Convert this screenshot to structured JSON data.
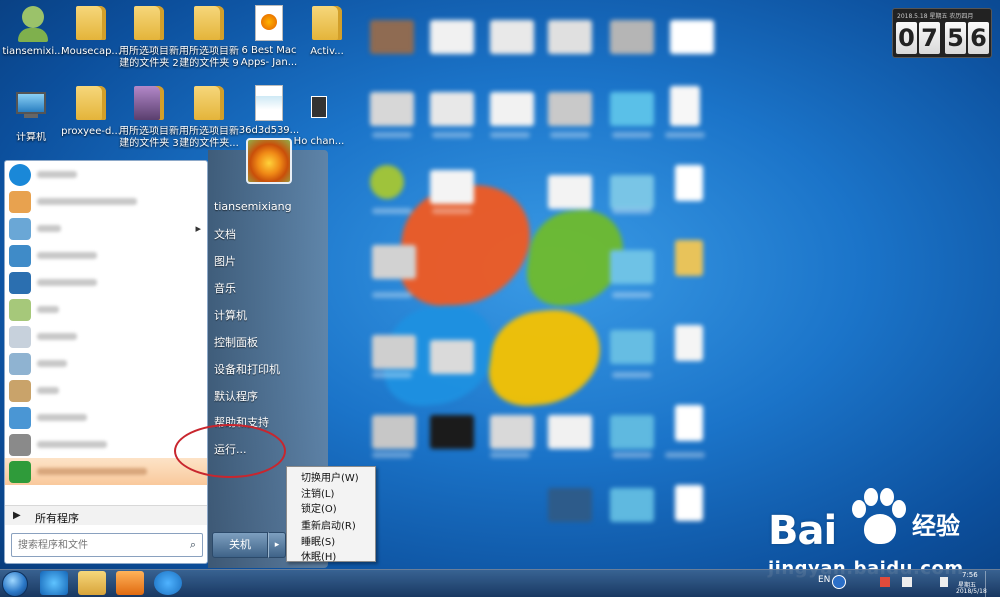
{
  "desktop": {
    "icons": [
      {
        "label": "tiansemixi..."
      },
      {
        "label": "Mousecap..."
      },
      {
        "label": "用所选项目新建的文件夹 2"
      },
      {
        "label": "用所选项目新建的文件夹 9"
      },
      {
        "label": "6 Best Mac Apps- Jan..."
      },
      {
        "label": "Activ..."
      },
      {
        "label": "计算机"
      },
      {
        "label": "proxyee-d..."
      },
      {
        "label": "用所选项目新建的文件夹 3"
      },
      {
        "label": "用所选项目新建的文件夹..."
      },
      {
        "label": "36d3d539..."
      },
      {
        "label": "Ho chan..."
      }
    ]
  },
  "clock_widget": {
    "header": "2018.5.18  星期五  农历四月",
    "digits": [
      "0",
      "7",
      "5",
      "6"
    ]
  },
  "start_menu": {
    "user_name": "tiansemixiang",
    "right_items": [
      {
        "label": "文档"
      },
      {
        "label": "图片"
      },
      {
        "label": "音乐"
      },
      {
        "label": "计算机"
      },
      {
        "label": "控制面板"
      },
      {
        "label": "设备和打印机"
      },
      {
        "label": "默认程序"
      },
      {
        "label": "帮助和支持"
      },
      {
        "label": "运行..."
      }
    ],
    "all_programs": "所有程序",
    "search_placeholder": "搜索程序和文件",
    "shutdown_label": "关机",
    "shutdown_arrow": "▸",
    "all_programs_arrow": "▶",
    "submenu_arrow": "▸",
    "search_icon_glyph": "⌕"
  },
  "power_submenu": {
    "items": [
      {
        "label": "切换用户(W)"
      },
      {
        "label": "注销(L)"
      },
      {
        "label": "锁定(O)"
      },
      {
        "label": "重新启动(R)"
      },
      {
        "label": "睡眠(S)"
      },
      {
        "label": "休眠(H)"
      }
    ]
  },
  "taskbar": {
    "lang": "EN",
    "time": "7:56",
    "day": "星期五",
    "date": "2018/5/18"
  },
  "watermark": {
    "brand": "Bai",
    "brand_cn": "经验",
    "url": "jingyan.baidu.com"
  },
  "colors": {
    "accent_red": "#c8262e",
    "start_menu_highlight": "#f9c99c"
  }
}
